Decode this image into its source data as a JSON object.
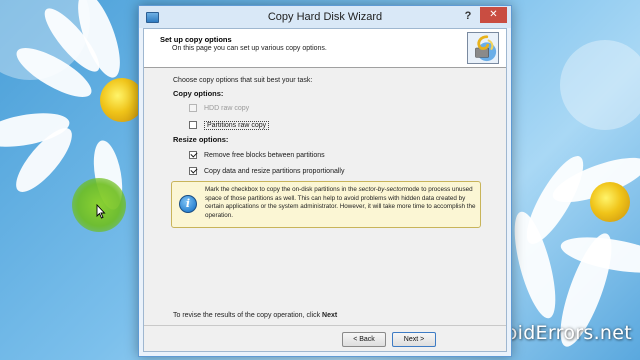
{
  "window": {
    "title": "Copy Hard Disk Wizard",
    "help_glyph": "?",
    "close_glyph": "✕"
  },
  "header": {
    "title": "Set up copy options",
    "subtitle": "On this page you can set up various copy options."
  },
  "intro": "Choose copy options that suit best your task:",
  "copy_options": {
    "label": "Copy options:",
    "items": [
      {
        "label": "HDD raw copy",
        "checked": false,
        "enabled": false
      },
      {
        "label": "Partitions raw copy",
        "checked": false,
        "enabled": true
      }
    ]
  },
  "resize_options": {
    "label": "Resize options:",
    "items": [
      {
        "label": "Remove free blocks between partitions",
        "checked": true,
        "enabled": true
      },
      {
        "label": "Copy data and resize partitions proportionally",
        "checked": true,
        "enabled": true
      }
    ]
  },
  "info": {
    "before": "Mark the checkbox to copy the on-disk partitions in the ",
    "emphasis": "sector-by-sector",
    "after": "mode to process unused space of those partitions as well. This can help to avoid problems with hidden data created by certain applications or the system administrator. However, it will take more time to accomplish the operation."
  },
  "footer": {
    "note_prefix": "To revise the results of the copy operation, click ",
    "note_bold": "Next"
  },
  "buttons": {
    "back": "< Back",
    "next": "Next >"
  },
  "watermark": "AvoidErrors.net",
  "colors": {
    "accent": "#3d7bc4",
    "close": "#c94d41",
    "info_bg": "#fbf6d4",
    "cursor_halo": "#8cd228"
  }
}
